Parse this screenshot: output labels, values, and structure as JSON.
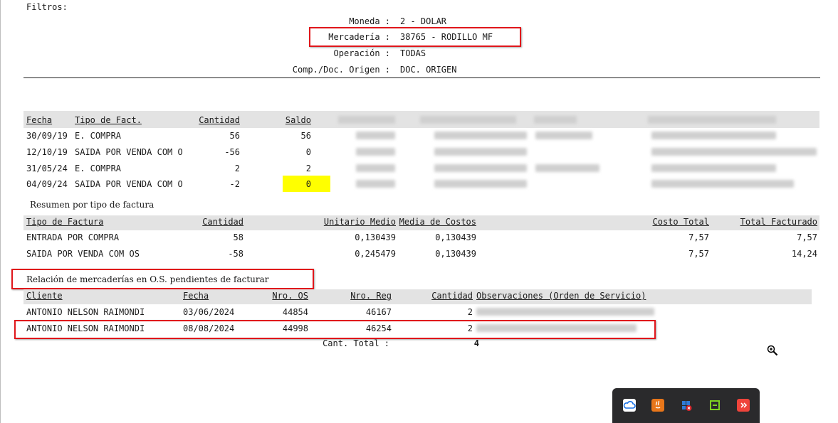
{
  "filtros_title": "Filtros:",
  "filters": [
    {
      "label": "Moneda :",
      "value": "2 - DOLAR"
    },
    {
      "label": "Mercadería :",
      "value": "38765 - RODILLO MF"
    },
    {
      "label": "Operación :",
      "value": "TODAS"
    },
    {
      "label": "Comp./Doc. Origen :",
      "value": "DOC. ORIGEN"
    }
  ],
  "movements": {
    "headers": [
      "Fecha",
      "Tipo de Fact.",
      "Cantidad",
      "Saldo"
    ],
    "rows": [
      {
        "fecha": "30/09/19",
        "tipo": "E. COMPRA",
        "cantidad": "56",
        "saldo": "56"
      },
      {
        "fecha": "12/10/19",
        "tipo": "SAIDA POR VENDA COM O",
        "cantidad": "-56",
        "saldo": "0"
      },
      {
        "fecha": "31/05/24",
        "tipo": "E. COMPRA",
        "cantidad": "2",
        "saldo": "2"
      },
      {
        "fecha": "04/09/24",
        "tipo": "SAIDA POR VENDA COM O",
        "cantidad": "-2",
        "saldo": "0"
      }
    ],
    "highlight_color": "#ffff00"
  },
  "resumen": {
    "title": "Resumen por tipo de factura",
    "headers": [
      "Tipo de Factura",
      "Cantidad",
      "Unitario Medio",
      "Media de Costos",
      "Costo Total",
      "Total Facturado"
    ],
    "rows": [
      {
        "tipo": "ENTRADA POR COMPRA",
        "cantidad": "58",
        "unitario": "0,130439",
        "media": "0,130439",
        "costo": "7,57",
        "facturado": "7,57"
      },
      {
        "tipo": "SAIDA POR VENDA COM OS",
        "cantidad": "-58",
        "unitario": "0,245479",
        "media": "0,130439",
        "costo": "7,57",
        "facturado": "14,24"
      }
    ]
  },
  "relacion": {
    "title": "Relación de mercaderías en O.S. pendientes de facturar",
    "headers": [
      "Cliente",
      "Fecha",
      "Nro. OS",
      "Nro. Reg",
      "Cantidad",
      "Observaciones (Orden de Servicio)"
    ],
    "rows": [
      {
        "cliente": "ANTONIO NELSON RAIMONDI",
        "fecha": "03/06/2024",
        "os": "44854",
        "reg": "46167",
        "cantidad": "2"
      },
      {
        "cliente": "ANTONIO NELSON RAIMONDI",
        "fecha": "08/08/2024",
        "os": "44998",
        "reg": "46254",
        "cantidad": "2"
      }
    ],
    "total_label": "Cant. Total :",
    "total_value": "4"
  },
  "annotation_color": "#e0161b",
  "taskbar_icons": [
    "cloud-icon",
    "java-icon",
    "shield-alert-icon",
    "network-icon",
    "anydesk-icon"
  ]
}
